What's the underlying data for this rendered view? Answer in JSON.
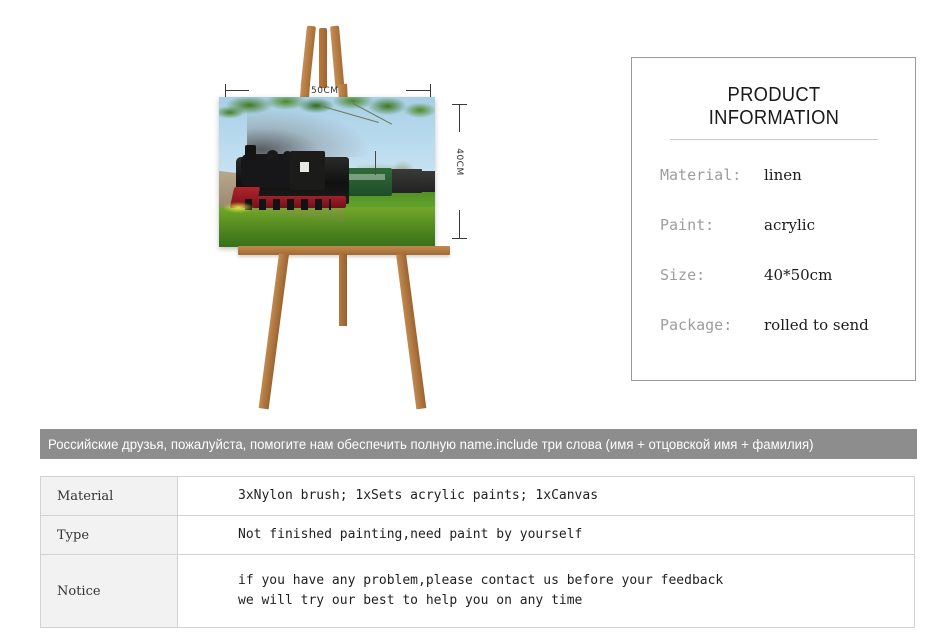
{
  "canvas_art": {
    "subject": "steam-locomotive-painting",
    "description": "Black steam locomotive with red undercarriage pulling green carriages on a track beside a stone path and green grass, blue sky with tree branches overhead"
  },
  "dimensions": {
    "width_label": "50CM",
    "height_label": "40CM"
  },
  "product_panel": {
    "title": "PRODUCT INFORMATION",
    "rows": [
      {
        "label": "Material:",
        "value": "linen"
      },
      {
        "label": "Paint:",
        "value": "acrylic"
      },
      {
        "label": "Size:",
        "value": "40*50cm"
      },
      {
        "label": "Package:",
        "value": "rolled to send"
      }
    ]
  },
  "banner": {
    "text": "Российские друзья, пожалуйста, помогите нам обеспечить полную name.include три слова (имя + отцовской имя + фамилия)",
    "background": "#8d8d8d",
    "color": "#ffffff"
  },
  "spec_table": {
    "rows": [
      {
        "key": "Material",
        "lines": [
          "3xNylon brush; 1xSets acrylic paints;  1xCanvas"
        ]
      },
      {
        "key": "Type",
        "lines": [
          "Not finished painting,need paint by yourself"
        ]
      },
      {
        "key": "Notice",
        "lines": [
          "if you have any problem,please contact us before your feedback",
          "we will try our best to help you on any time"
        ]
      }
    ]
  }
}
